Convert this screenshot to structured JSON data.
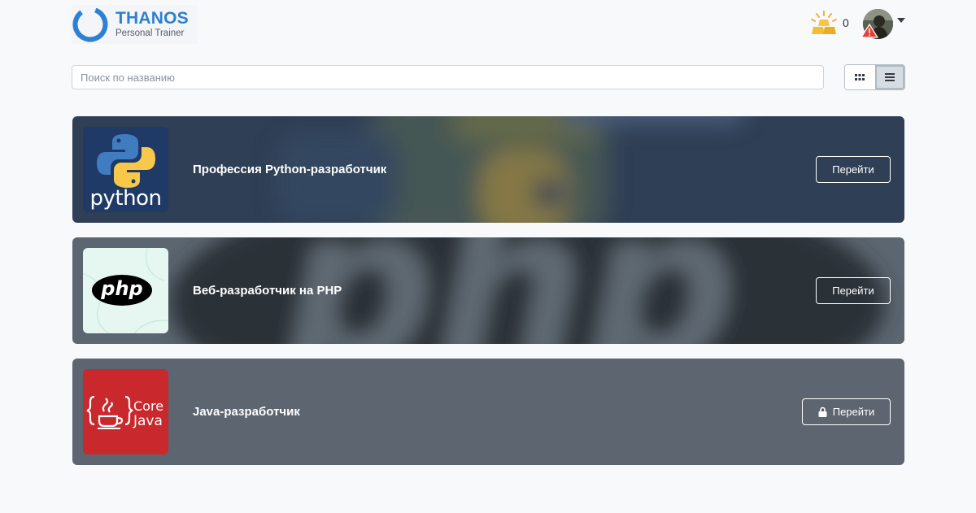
{
  "header": {
    "logo": {
      "title": "THANOS",
      "subtitle": "Personal Trainer"
    },
    "coins": {
      "icon": "gold-bars-icon",
      "count": "0"
    },
    "avatar": {
      "icon": "user-avatar",
      "warning_icon": "warning-icon"
    }
  },
  "search": {
    "placeholder": "Поиск по названию",
    "value": ""
  },
  "view_toggle": {
    "options": [
      "grid",
      "list"
    ],
    "active": "list"
  },
  "courses": [
    {
      "title": "Профессия Python-разработчик",
      "button": "Перейти",
      "locked": false,
      "thumb_text": "python",
      "colors": {
        "bg": "#2f3f55"
      }
    },
    {
      "title": "Веб-разработчик на PHP",
      "button": "Перейти",
      "locked": false,
      "thumb_text": "php",
      "colors": {
        "bg": "#5c6670"
      }
    },
    {
      "title": "Java-разработчик",
      "button": "Перейти",
      "locked": true,
      "thumb_text": [
        "Core",
        "Java"
      ],
      "colors": {
        "bg": "#5d6570"
      }
    }
  ],
  "colors": {
    "brand": "#2d80d2",
    "page_bg": "#f8f9fb",
    "java_red": "#c9282d"
  }
}
